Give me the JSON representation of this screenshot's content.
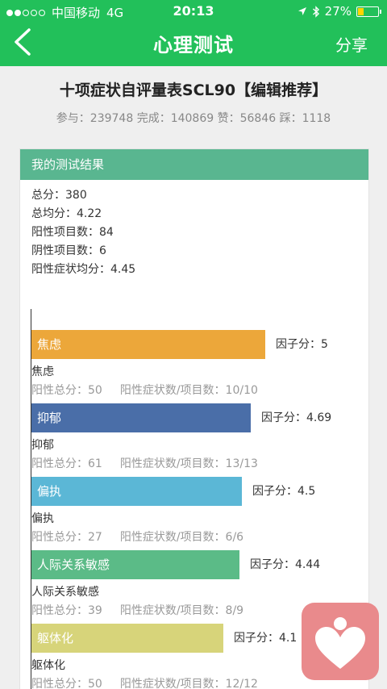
{
  "status_bar": {
    "carrier": "中国移动",
    "network": "4G",
    "time": "20:13",
    "battery_pct": "27%"
  },
  "nav": {
    "title": "心理测试",
    "share_label": "分享"
  },
  "test": {
    "title": "十项症状自评量表SCL90【编辑推荐】",
    "stats": "参与：239748 完成：140869 赞：56846 踩：1118"
  },
  "result_card": {
    "header": "我的测试结果",
    "lines": [
      "总分：380",
      "总均分：4.22",
      "阳性项目数：84",
      "阴性项目数：6",
      "阳性症状均分：4.45"
    ]
  },
  "chart_data": {
    "type": "bar",
    "orientation": "horizontal",
    "categories": [
      "焦虑",
      "抑郁",
      "偏执",
      "人际关系敏感",
      "躯体化"
    ],
    "values": [
      5,
      4.69,
      4.5,
      4.44,
      4.1
    ],
    "value_labels": [
      "因子分：5",
      "因子分：4.69",
      "因子分：4.5",
      "因子分：4.44",
      "因子分：4.1"
    ],
    "positive_total_labels": [
      "阳性总分：50",
      "阳性总分：61",
      "阳性总分：27",
      "阳性总分：39",
      "阳性总分：50"
    ],
    "positive_count_labels": [
      "阳性症状数/项目数：10/10",
      "阳性症状数/项目数：13/13",
      "阳性症状数/项目数：6/6",
      "阳性症状数/项目数：8/9",
      "阳性症状数/项目数：12/12"
    ],
    "colors": [
      "#eca73a",
      "#4a6ea8",
      "#5bb7d6",
      "#5bbb87",
      "#d7d47a"
    ],
    "xlim": [
      0,
      5
    ]
  },
  "icons": {
    "back": "chevron-left-icon",
    "fab": "heart-person-icon",
    "location": "location-arrow-icon",
    "bluetooth": "bluetooth-icon"
  }
}
